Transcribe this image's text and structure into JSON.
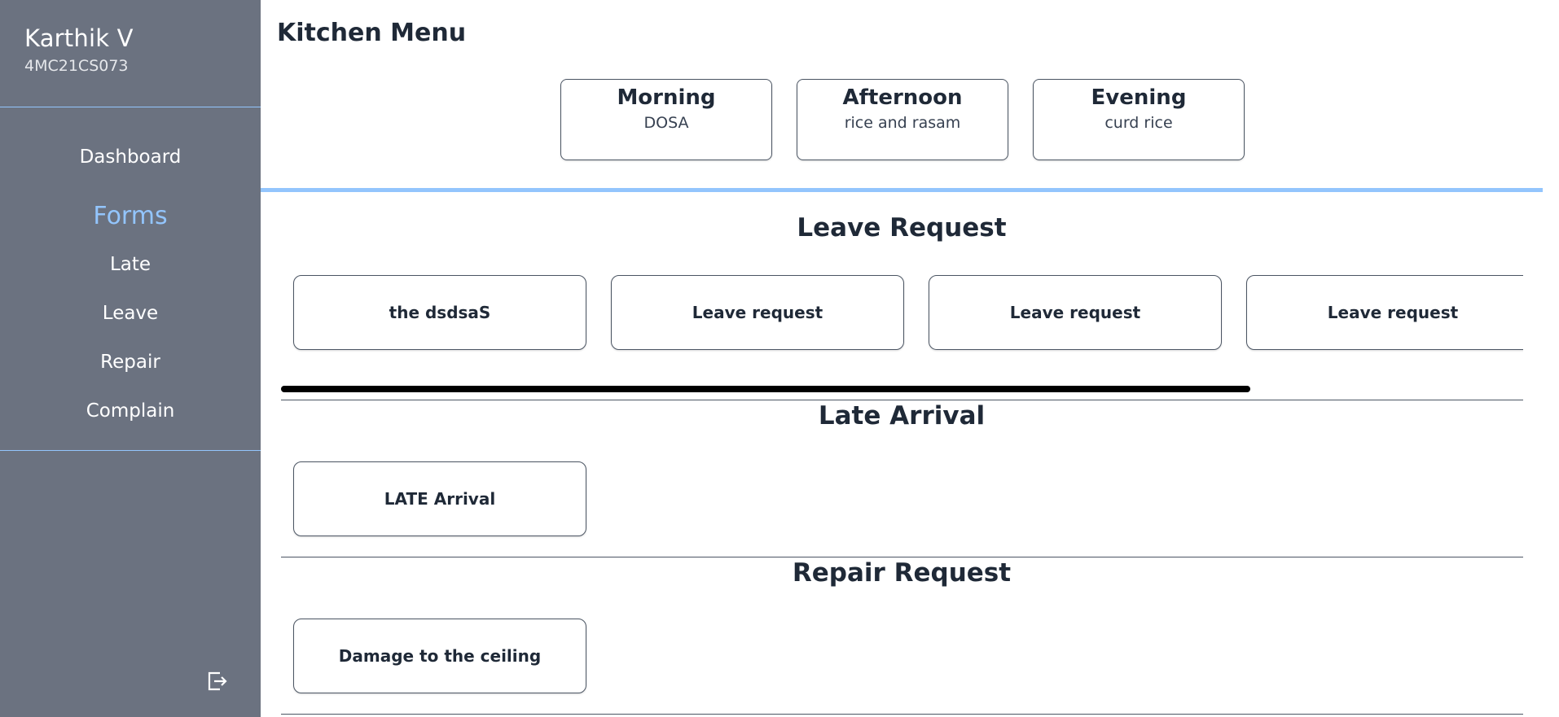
{
  "sidebar": {
    "user_name": "Karthik V",
    "user_id": "4MC21CS073",
    "nav": {
      "dashboard": "Dashboard",
      "forms": "Forms",
      "late": "Late",
      "leave": "Leave",
      "repair": "Repair",
      "complain": "Complain"
    },
    "logout_icon": "logout-icon"
  },
  "kitchen": {
    "title": "Kitchen Menu",
    "meals": [
      {
        "name": "Morning",
        "food": "DOSA"
      },
      {
        "name": "Afternoon",
        "food": "rice and rasam"
      },
      {
        "name": "Evening",
        "food": "curd rice"
      }
    ]
  },
  "leave_section": {
    "title": "Leave Request",
    "cards": [
      "the dsdsaS",
      "Leave request",
      "Leave request",
      "Leave request"
    ]
  },
  "late_section": {
    "title": "Late Arrival",
    "cards": [
      "LATE Arrival"
    ]
  },
  "repair_section": {
    "title": "Repair Request",
    "cards": [
      "Damage to the ceiling"
    ]
  },
  "colors": {
    "sidebar_bg": "#6b7280",
    "accent": "#93c5fd",
    "text": "#1f2937"
  }
}
